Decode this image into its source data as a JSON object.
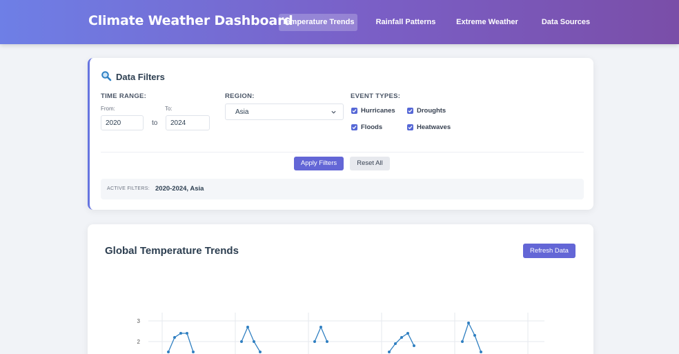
{
  "header": {
    "title": "Climate Weather Dashboard",
    "nav": [
      {
        "label": "Temperature Trends",
        "active": true
      },
      {
        "label": "Rainfall Patterns",
        "active": false
      },
      {
        "label": "Extreme Weather",
        "active": false
      },
      {
        "label": "Data Sources",
        "active": false
      }
    ]
  },
  "filters": {
    "icon": "search-icon",
    "title": "Data Filters",
    "time_range": {
      "label": "TIME RANGE:",
      "from_label": "From:",
      "from_value": "2020",
      "to_label": "To:",
      "to_value": "2024",
      "separator": "to"
    },
    "region": {
      "label": "REGION:",
      "selected": "Asia"
    },
    "event_types": {
      "label": "EVENT TYPES:",
      "options": [
        {
          "label": "Hurricanes",
          "checked": true
        },
        {
          "label": "Droughts",
          "checked": true
        },
        {
          "label": "Floods",
          "checked": true
        },
        {
          "label": "Heatwaves",
          "checked": true
        }
      ]
    },
    "apply_label": "Apply Filters",
    "reset_label": "Reset All",
    "active": {
      "caption": "ACTIVE FILTERS:",
      "value": "2020-2024, Asia"
    }
  },
  "chart_section": {
    "title": "Global Temperature Trends",
    "refresh_label": "Refresh Data"
  },
  "colors": {
    "accent": "#6366d6",
    "line": "#2f7fc1",
    "header_start": "#6e7fe6",
    "header_end": "#7a4ea8"
  },
  "chart_data": {
    "type": "line",
    "yticks": [
      2,
      3
    ],
    "grid": true,
    "series": [
      {
        "values": [
          1.5,
          2.2,
          2.4,
          2.4,
          1.5
        ]
      },
      {
        "values": [
          2.0,
          2.7,
          2.0,
          1.5
        ]
      },
      {
        "values": [
          2.0,
          2.7,
          2.0
        ]
      },
      {
        "values": [
          1.5,
          1.9,
          2.2,
          2.4,
          1.8
        ]
      },
      {
        "values": [
          2.0,
          2.9,
          2.3,
          1.5
        ]
      }
    ]
  }
}
